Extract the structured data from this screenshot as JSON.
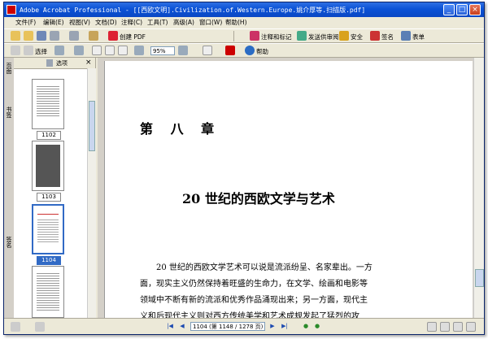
{
  "window": {
    "title": "Adobe Acrobat Professional - [[西欧文明].Civilization.of.Western.Europe.姚介厚等.扫描版.pdf]"
  },
  "menu": [
    "文件(F)",
    "编辑(E)",
    "视图(V)",
    "文档(D)",
    "注释(C)",
    "工具(T)",
    "高级(A)",
    "窗口(W)",
    "帮助(H)"
  ],
  "toolbar1": {
    "labels": {
      "create_pdf": "创建 PDF",
      "annotate": "注释和标记",
      "send_review": "发送供审阅",
      "security": "安全",
      "sign": "签名",
      "forms": "表单"
    }
  },
  "toolbar2": {
    "select": "选择",
    "zoom": "95%",
    "help": "帮助"
  },
  "panel": {
    "options": "选项",
    "close": "×",
    "tabs": [
      "页面",
      "书签",
      "签名"
    ]
  },
  "thumbnails": [
    {
      "label": "1102",
      "selected": false
    },
    {
      "label": "1103",
      "selected": false
    },
    {
      "label": "1104",
      "selected": true
    }
  ],
  "document": {
    "chapter": "第 八 章",
    "title": "20 世纪的西欧文学与艺术",
    "paragraph": [
      "　　20 世纪的西欧文学艺术可以说是流派纷呈、名家辈出。一方",
      "面，现实主义仍然保持着旺盛的生命力，在文学、绘画和电影等",
      "领域中不断有新的流派和优秀作品涌现出来；另一方面，现代主",
      "义和后现代主义则对西方传统美学和艺术成规发起了猛烈的攻"
    ]
  },
  "status": {
    "page_field": "1104 (第 1148 / 1278 页)"
  },
  "colors": {
    "titlebar": "#0b52d6",
    "selected": "#316ac5"
  }
}
